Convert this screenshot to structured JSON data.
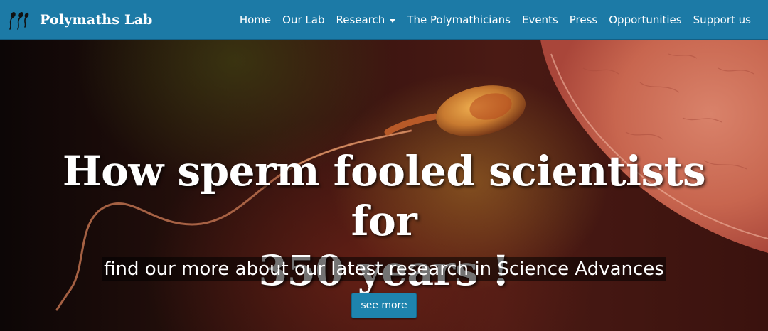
{
  "brand": {
    "name": "Polymaths Lab",
    "logo_icon": "sperm-logo-icon"
  },
  "nav": {
    "items": [
      {
        "label": "Home"
      },
      {
        "label": "Our Lab"
      },
      {
        "label": "Research",
        "dropdown": true
      },
      {
        "label": "The Polymathicians"
      },
      {
        "label": "Events"
      },
      {
        "label": "Press"
      },
      {
        "label": "Opportunities"
      },
      {
        "label": "Support us"
      }
    ]
  },
  "hero": {
    "headline_line1": "How sperm fooled scientists for",
    "headline_line2": "350 years !",
    "subline": "find our more about our latest research in Science Advances",
    "button_label": "see more"
  },
  "colors": {
    "navbar": "#1c7aa6",
    "button": "#1e84ae",
    "text": "#ffffff"
  }
}
